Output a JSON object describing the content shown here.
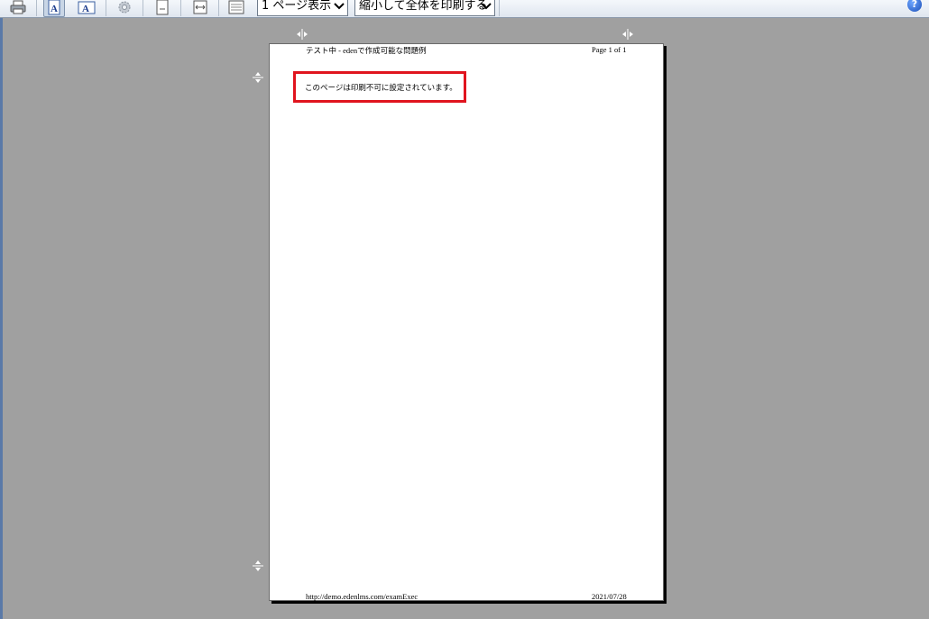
{
  "toolbar": {
    "page_view_select": "1 ページ表示",
    "print_mode_select": "縮小して全体を印刷する",
    "help_label": "?"
  },
  "page": {
    "header_left": "テスト中 - edenで作成可能な問題例",
    "header_right": "Page 1 of 1",
    "message": "このページは印刷不可に設定されています。",
    "footer_left": "http://demo.edenlms.com/examExec",
    "footer_right": "2021/07/28"
  },
  "colors": {
    "background": "#a0a0a0",
    "highlight_box": "#e0141e"
  }
}
